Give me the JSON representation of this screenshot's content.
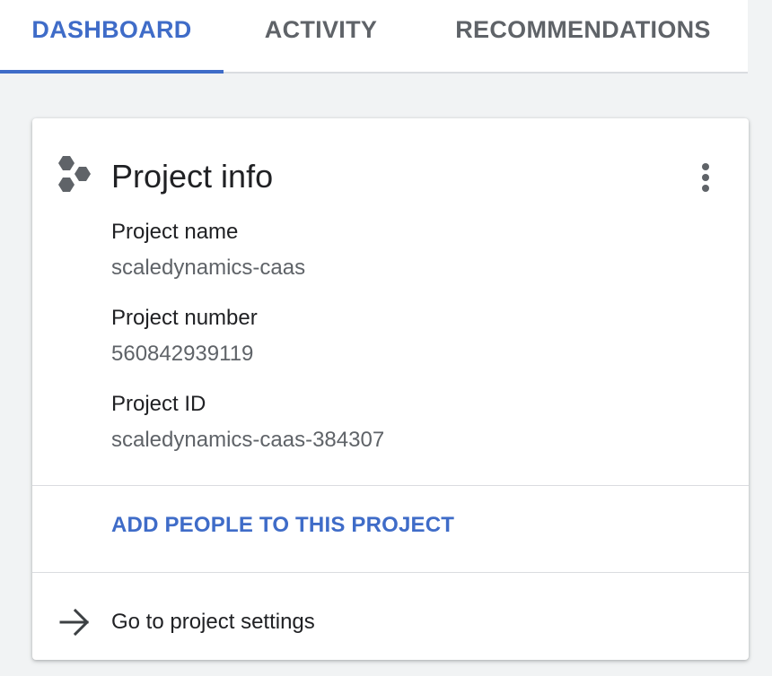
{
  "tabs": [
    {
      "label": "DASHBOARD",
      "active": true
    },
    {
      "label": "ACTIVITY",
      "active": false
    },
    {
      "label": "RECOMMENDATIONS",
      "active": false
    }
  ],
  "card": {
    "title": "Project info",
    "icon": "hexagons-icon",
    "menu_icon": "more-vert-icon",
    "fields": [
      {
        "label": "Project name",
        "value": "scaledynamics-caas"
      },
      {
        "label": "Project number",
        "value": "560842939119"
      },
      {
        "label": "Project ID",
        "value": "scaledynamics-caas-384307"
      }
    ],
    "add_people_label": "ADD PEOPLE TO THIS PROJECT",
    "settings_label": "Go to project settings",
    "settings_icon": "arrow-right-icon"
  },
  "colors": {
    "accent": "#3f6cc8",
    "text_primary": "#202124",
    "text_secondary": "#5f6368",
    "divider": "#dadce0",
    "background": "#f1f3f4"
  }
}
